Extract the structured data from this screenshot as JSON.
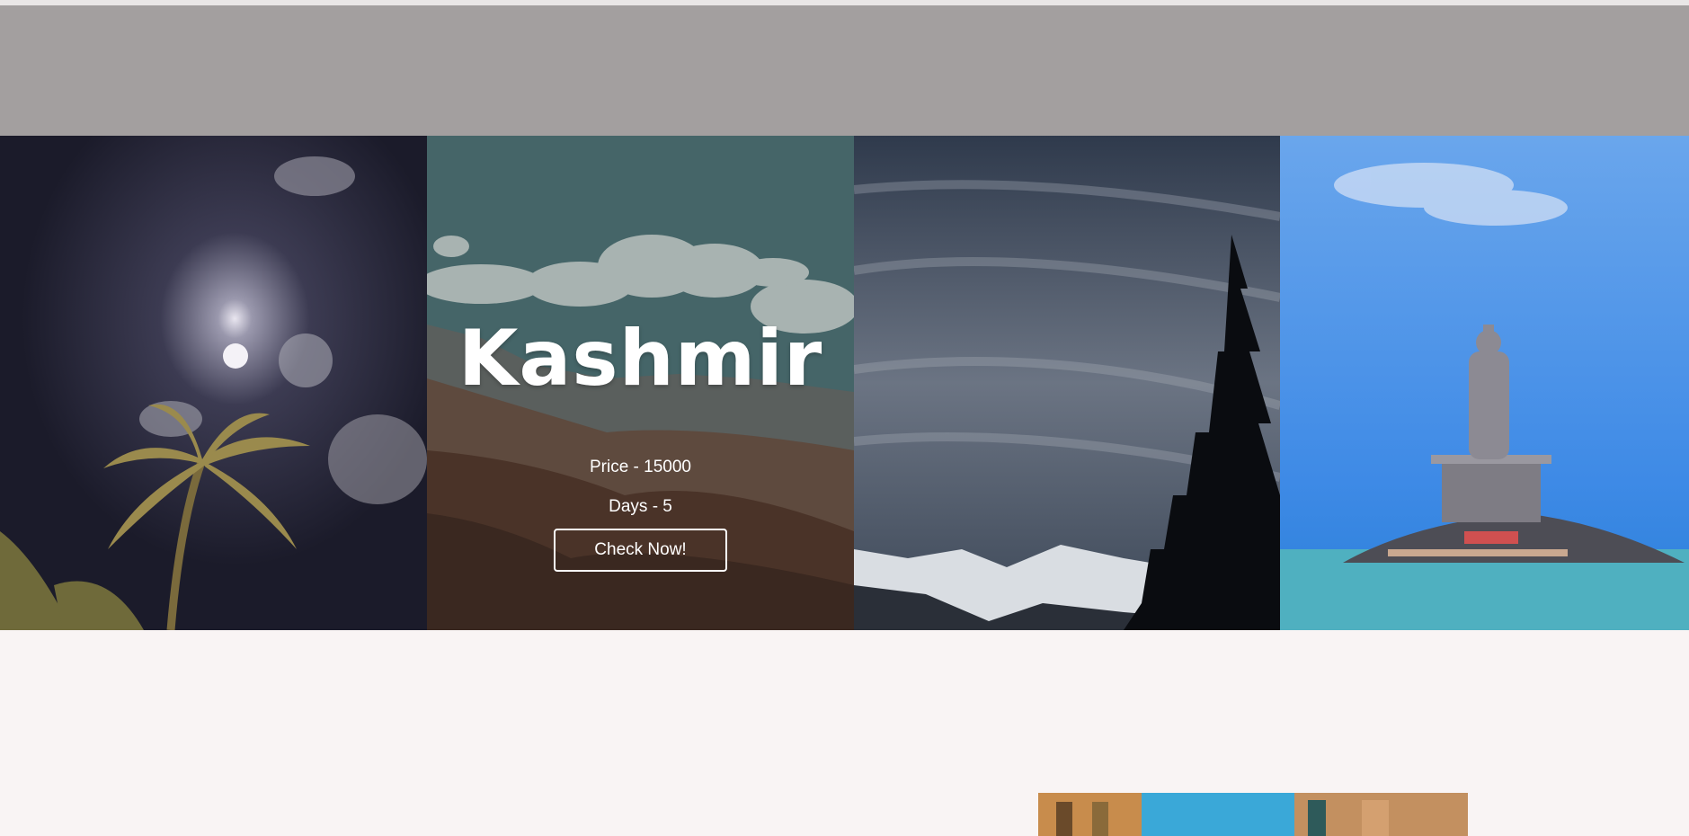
{
  "featured": {
    "title": "Kashmir",
    "price": "Price - 15000",
    "days": "Days - 5",
    "cta": "Check Now!"
  },
  "gallery": {
    "cards": [
      {
        "scene": "palm-tree-night-sky-photo"
      },
      {
        "scene": "kashmir-mountains-photo"
      },
      {
        "scene": "pine-tree-snow-mountains-photo"
      },
      {
        "scene": "thiruvalluvar-statue-sea-photo"
      }
    ]
  },
  "lower_section": {
    "scene": "colorful-street-buildings-photo"
  }
}
